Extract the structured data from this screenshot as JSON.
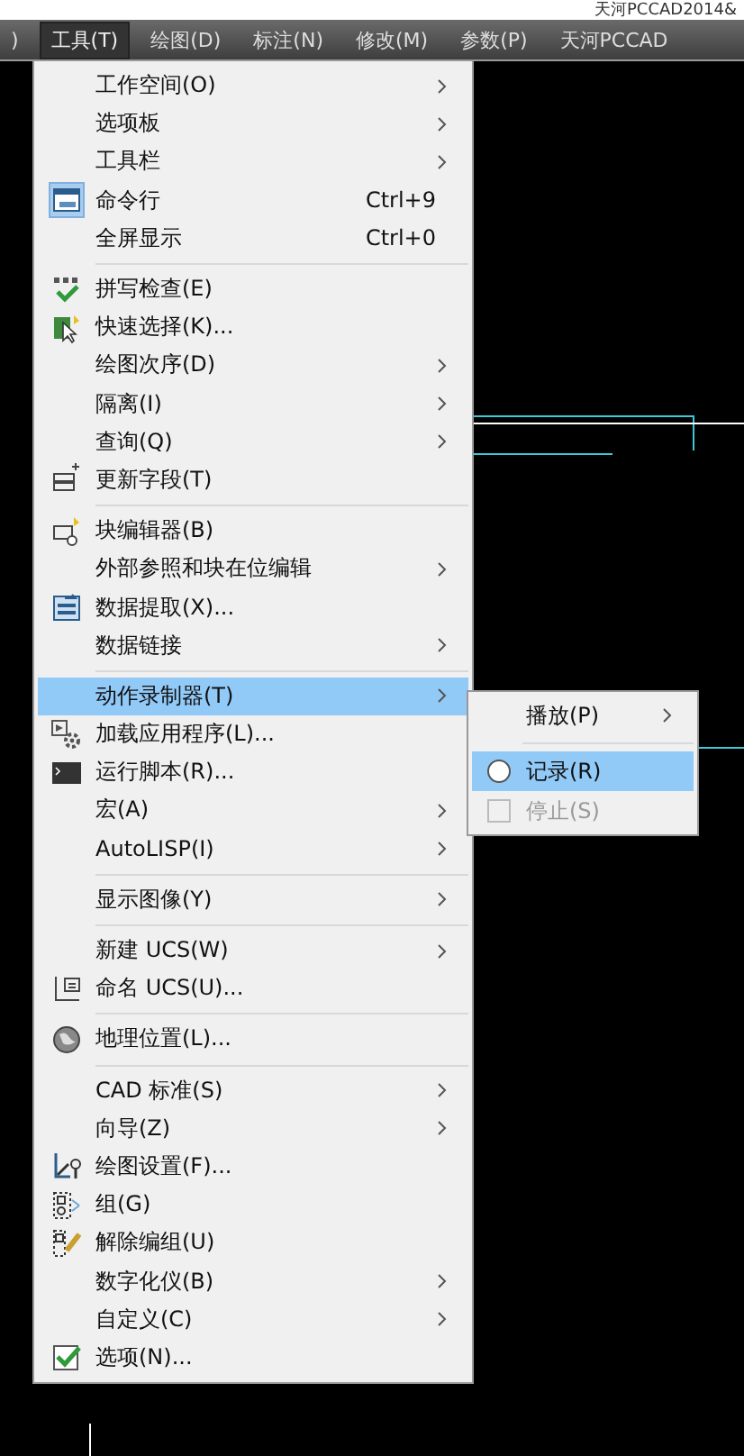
{
  "title_strip": {
    "text": "天河PCCAD2014&"
  },
  "menu_bar": [
    {
      "label": ")",
      "selected": false
    },
    {
      "label": "工具(T)",
      "selected": true
    },
    {
      "label": "绘图(D)",
      "selected": false
    },
    {
      "label": "标注(N)",
      "selected": false
    },
    {
      "label": "修改(M)",
      "selected": false
    },
    {
      "label": "参数(P)",
      "selected": false
    },
    {
      "label": "天河PCCAD",
      "selected": false
    }
  ],
  "dropdown": {
    "groups": [
      [
        {
          "label": "工作空间(O)",
          "has_submenu": true,
          "selected": false,
          "checked": false
        },
        {
          "label": "选项板",
          "has_submenu": true,
          "selected": false,
          "checked": false
        },
        {
          "label": "工具栏",
          "has_submenu": true,
          "selected": false,
          "checked": false
        },
        {
          "label": "命令行",
          "shortcut": "Ctrl+9",
          "has_submenu": false,
          "selected": false,
          "checked": true
        },
        {
          "label": "全屏显示",
          "shortcut": "Ctrl+0",
          "has_submenu": false,
          "selected": false,
          "checked": false
        }
      ],
      [
        {
          "label": "拼写检查(E)",
          "has_submenu": false,
          "selected": false,
          "checked": false
        },
        {
          "label": "快速选择(K)...",
          "has_submenu": false,
          "selected": false,
          "checked": false
        },
        {
          "label": "绘图次序(D)",
          "has_submenu": true,
          "selected": false,
          "checked": false
        },
        {
          "label": "隔离(I)",
          "has_submenu": true,
          "selected": false,
          "checked": false
        },
        {
          "label": "查询(Q)",
          "has_submenu": true,
          "selected": false,
          "checked": false
        },
        {
          "label": "更新字段(T)",
          "has_submenu": false,
          "selected": false,
          "checked": false
        }
      ],
      [
        {
          "label": "块编辑器(B)",
          "has_submenu": false,
          "selected": false,
          "checked": false
        },
        {
          "label": "外部参照和块在位编辑",
          "has_submenu": true,
          "selected": false,
          "checked": false
        },
        {
          "label": "数据提取(X)...",
          "has_submenu": false,
          "selected": false,
          "checked": false
        },
        {
          "label": "数据链接",
          "has_submenu": true,
          "selected": false,
          "checked": false
        }
      ],
      [
        {
          "label": "动作录制器(T)",
          "has_submenu": true,
          "selected": true,
          "checked": false
        },
        {
          "label": "加载应用程序(L)...",
          "has_submenu": false,
          "selected": false,
          "checked": false
        },
        {
          "label": "运行脚本(R)...",
          "has_submenu": false,
          "selected": false,
          "checked": false
        },
        {
          "label": "宏(A)",
          "has_submenu": true,
          "selected": false,
          "checked": false
        },
        {
          "label": "AutoLISP(I)",
          "has_submenu": true,
          "selected": false,
          "checked": false
        }
      ],
      [
        {
          "label": "显示图像(Y)",
          "has_submenu": true,
          "selected": false,
          "checked": false
        }
      ],
      [
        {
          "label": "新建 UCS(W)",
          "has_submenu": true,
          "selected": false,
          "checked": false
        },
        {
          "label": "命名 UCS(U)...",
          "has_submenu": false,
          "selected": false,
          "checked": false
        }
      ],
      [
        {
          "label": "地理位置(L)...",
          "has_submenu": false,
          "selected": false,
          "checked": false
        }
      ],
      [
        {
          "label": "CAD 标准(S)",
          "has_submenu": true,
          "selected": false,
          "checked": false
        },
        {
          "label": "向导(Z)",
          "has_submenu": true,
          "selected": false,
          "checked": false
        },
        {
          "label": "绘图设置(F)...",
          "has_submenu": false,
          "selected": false,
          "checked": false
        },
        {
          "label": "组(G)",
          "has_submenu": false,
          "selected": false,
          "checked": false
        },
        {
          "label": "解除编组(U)",
          "has_submenu": false,
          "selected": false,
          "checked": false
        },
        {
          "label": "数字化仪(B)",
          "has_submenu": true,
          "selected": false,
          "checked": false
        },
        {
          "label": "自定义(C)",
          "has_submenu": true,
          "selected": false,
          "checked": false
        },
        {
          "label": "选项(N)...",
          "has_submenu": false,
          "selected": false,
          "checked": false
        }
      ]
    ]
  },
  "submenu": {
    "groups": [
      [
        {
          "label": "播放(P)",
          "kind": "plain",
          "has_submenu": true,
          "selected": false,
          "disabled": false
        }
      ],
      [
        {
          "label": "记录(R)",
          "kind": "radio",
          "has_submenu": false,
          "selected": true,
          "disabled": false
        },
        {
          "label": "停止(S)",
          "kind": "check",
          "has_submenu": false,
          "selected": false,
          "disabled": true
        }
      ]
    ]
  }
}
